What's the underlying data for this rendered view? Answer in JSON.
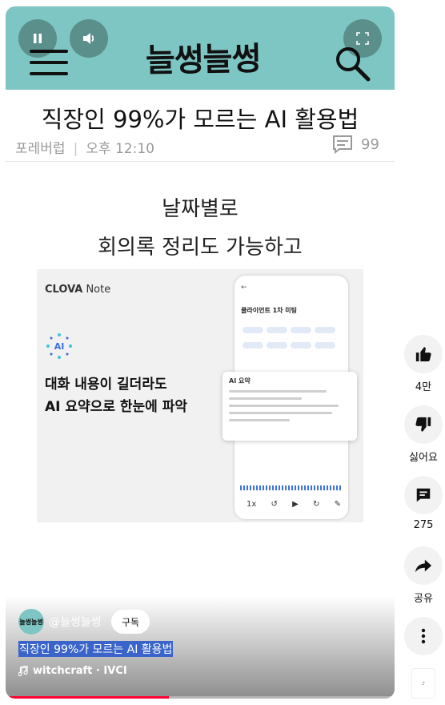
{
  "header": {
    "logo_text": "늘썽늘썽",
    "bg_color": "#7dc6c3"
  },
  "post": {
    "title": "직장인 99%가 모르는 AI 활용법",
    "author": "포레버럽",
    "time": "오후 12:10",
    "comment_count": "99"
  },
  "captions": [
    "날짜별로",
    "회의록 정리도 가능하고"
  ],
  "slide": {
    "app_name_bold": "CLOVA",
    "app_name_rest": " Note",
    "ai_badge": "AI",
    "headline_line1": "대화 내용이 길더라도",
    "headline_line2": "AI 요약으로 한눈에 파악",
    "phone_meeting_title": "클라이언트 1차 미팅",
    "ai_summary_title": "AI 요약"
  },
  "channel": {
    "avatar_text": "늘썽늘썽",
    "handle": "@늘썽늘썽",
    "subscribe_label": "구독"
  },
  "video": {
    "title": "직장인 99%가 모르는 AI 활용법",
    "music": "witchcraft · IVCI",
    "progress_fraction": 0.42
  },
  "actions": {
    "like_count": "4만",
    "dislike_label": "싫어요",
    "comment_count": "275",
    "share_label": "공유"
  },
  "icons": [
    "pause-icon",
    "volume-icon",
    "fullscreen-icon",
    "hamburger-icon",
    "search-icon",
    "comment-icon",
    "thumbs-up-icon",
    "thumbs-down-icon",
    "share-icon",
    "more-icon",
    "music-note-icon"
  ]
}
